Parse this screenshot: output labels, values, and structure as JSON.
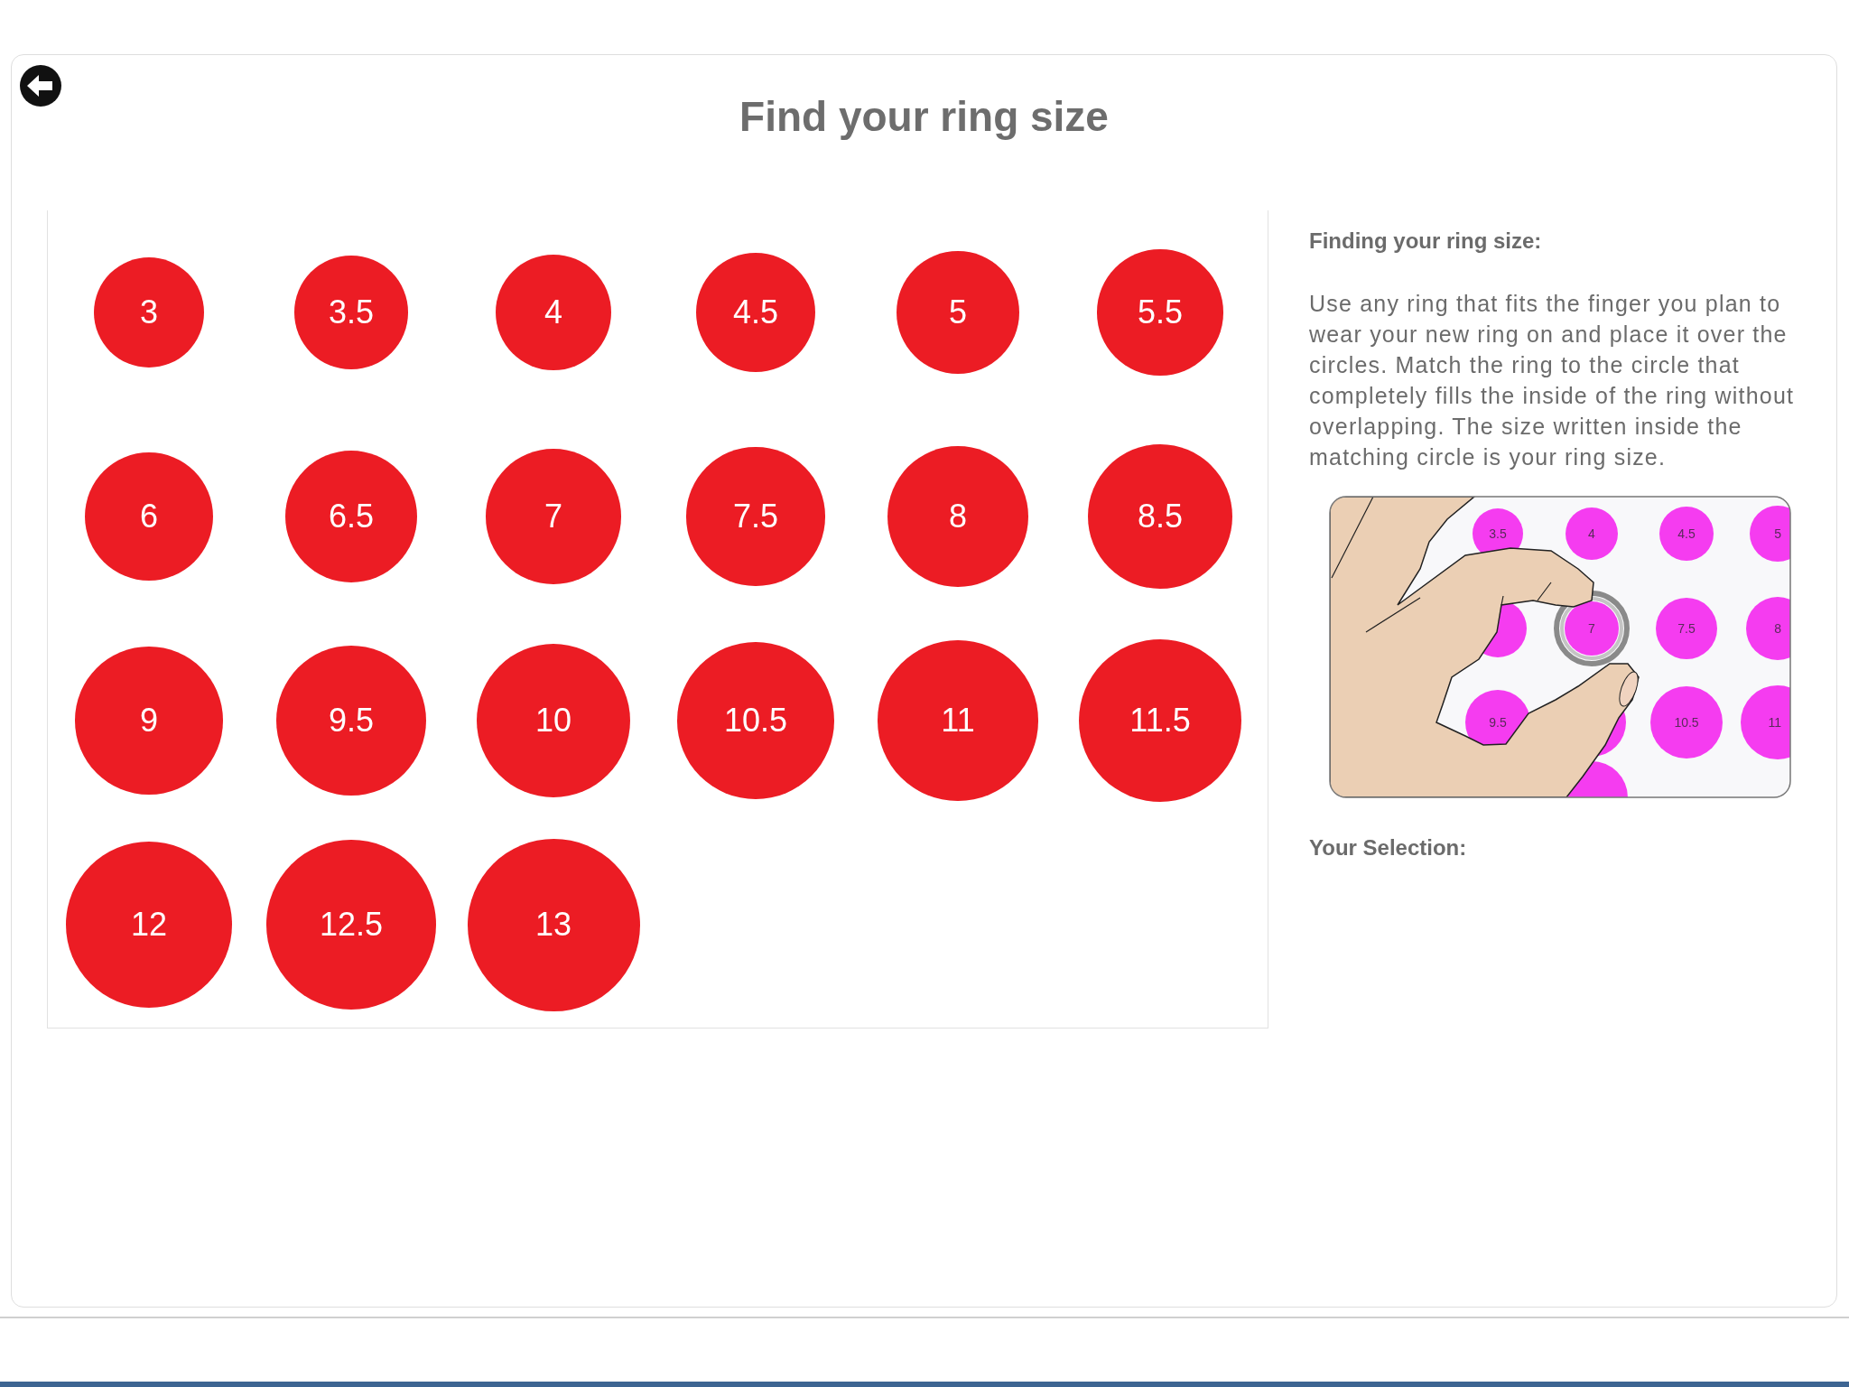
{
  "title": "Find your ring size",
  "sizes": [
    "3",
    "3.5",
    "4",
    "4.5",
    "5",
    "5.5",
    "6",
    "6.5",
    "7",
    "7.5",
    "8",
    "8.5",
    "9",
    "9.5",
    "10",
    "10.5",
    "11",
    "11.5",
    "12",
    "12.5",
    "13"
  ],
  "instructions": {
    "heading": "Finding your ring size:",
    "text": "Use any ring that fits the finger you plan to wear your new ring on and place it over the circles. Match the ring to the circle that completely fills the inside of the ring without overlapping. The size written inside the matching circle is your ring size."
  },
  "illustration": {
    "circle_labels": [
      "3.5",
      "4",
      "4.5",
      "5",
      "7",
      "7.5",
      "8",
      "9.5",
      "10.5",
      "11"
    ]
  },
  "selection": {
    "label": "Your Selection:"
  }
}
